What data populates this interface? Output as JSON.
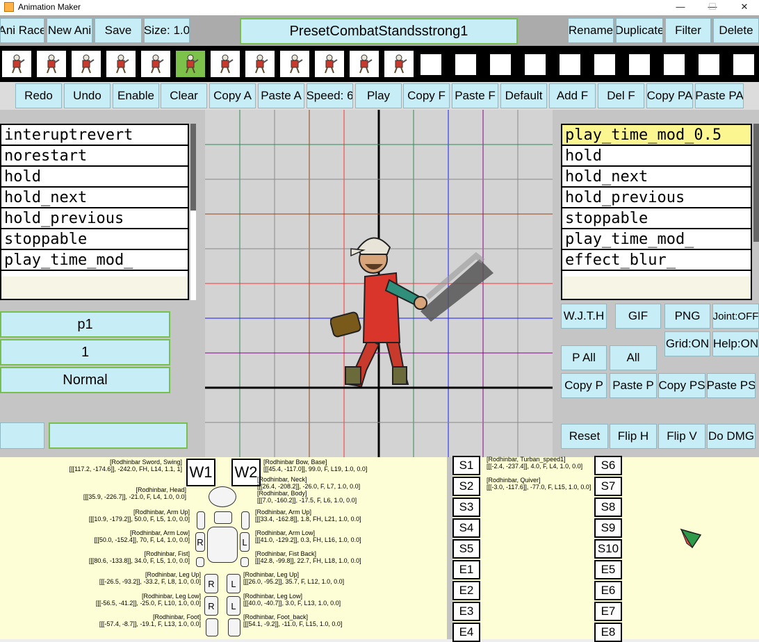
{
  "window": {
    "title": "Animation Maker",
    "minimize": "—",
    "maximize": "☐",
    "close": "✕"
  },
  "top_buttons": {
    "ani_race": "Ani Race",
    "new_ani": "New Ani",
    "save": "Save",
    "size": "Size: 1.0",
    "animation_name": "PresetCombatStandsstrong1",
    "rename": "Rename",
    "duplicate": "Duplicate",
    "filter": "Filter",
    "delete": "Delete"
  },
  "filmstrip": {
    "filled_frames": 12,
    "selected_frame": 6,
    "empty_frames": 10
  },
  "toolbar": [
    "Redo",
    "Undo",
    "Enable",
    "Clear",
    "Copy A",
    "Paste A",
    "Speed: 6",
    "Play",
    "Copy F",
    "Paste F",
    "Default",
    "Add F",
    "Del F",
    "Copy PA",
    "Paste PA"
  ],
  "left_list": [
    "interuptrevert",
    "norestart",
    "hold",
    "hold_next",
    "hold_previous",
    "stoppable",
    "play_time_mod_"
  ],
  "right_list": {
    "items": [
      "play_time_mod_0.5",
      "hold",
      "hold_next",
      "hold_previous",
      "stoppable",
      "play_time_mod_",
      "effect_blur_"
    ],
    "highlighted": "play_time_mod_0.5"
  },
  "left_fields": {
    "p": "p1",
    "value": "1",
    "mode": "Normal"
  },
  "right_buttons": {
    "wjth": "W.J.T.H",
    "gif": "GIF",
    "png": "PNG",
    "joint": "Joint:OFF",
    "grid": "Grid:ON",
    "help": "Help:ON",
    "p_all": "P All",
    "all": "All",
    "copy_p": "Copy P",
    "paste_p": "Paste P",
    "copy_ps": "Copy PS",
    "paste_ps": "Paste PS",
    "reset": "Reset",
    "flip_h": "Flip H",
    "flip_v": "Flip V",
    "do_dmg": "Do DMG"
  },
  "skeleton": {
    "w1": "W1",
    "w2": "W2",
    "r": "R",
    "l": "L",
    "labels_left": [
      {
        "name": "[Rodhinbar Sword, Swing]",
        "value": "[[[117.2, -174.6]], -242.0, FH, L14, 1.1, 1]"
      },
      {
        "name": "[Rodhinbar, Head]",
        "value": "[[[35.9, -226.7]], -21.0, F, L4, 1.0, 0.0]"
      },
      {
        "name": "[Rodhinbar, Arm Up]",
        "value": "[[[10.9, -179.2]], 50.0, F, L5, 1.0, 0.0]"
      },
      {
        "name": "[Rodhinbar, Arm Low]",
        "value": "[[[50.0, -152.4]], 70, F, L4, 1.0, 0.0]"
      },
      {
        "name": "[Rodhinbar, Fist]",
        "value": "[[[80.6, -133.8]], 34.0, F, L5, 1.0, 0.0]"
      },
      {
        "name": "[Rodhinbar, Leg Up]",
        "value": "[[[-26.5, -93.2]], -33.2, F, L8, 1.0, 0.0]"
      },
      {
        "name": "[Rodhinbar, Leg Low]",
        "value": "[[[-56.5, -41.2]], -25.0, F, L10, 1.0, 0.0]"
      },
      {
        "name": "[Rodhinbar, Foot]",
        "value": "[[[-57.4, -8.7]], -19.1, F, L13, 1.0, 0.0]"
      }
    ],
    "labels_right": [
      {
        "name": "[Rodhinbar Bow, Base]",
        "value": "[[[45.4, -117.0]], 99.0, F, L19, 1.0, 0.0]"
      },
      {
        "name": "[Rodhinbar, Neck]",
        "value": "[[[26.4, -208.2]], -26.0, F, L7, 1.0, 0.0]"
      },
      {
        "name": "[Rodhinbar, Body]",
        "value": "[[[7.0, -160.2]], -17.5, F, L6, 1.0, 0.0]"
      },
      {
        "name": "[Rodhinbar, Arm Up]",
        "value": "[[[33.4, -162.8]], 1.8, FH, L21, 1.0, 0.0]"
      },
      {
        "name": "[Rodhinbar, Arm Low]",
        "value": "[[[41.0, -129.2]], 0.3, FH, L16, 1.0, 0.0]"
      },
      {
        "name": "[Rodhinbar, Fist Back]",
        "value": "[[[42.8, -99.8]], 22.7, FH, L18, 1.0, 0.0]"
      },
      {
        "name": "[Rodhinbar, Leg Up]",
        "value": "[[[26.0, -95.2]], 35.7, F, L12, 1.0, 0.0]"
      },
      {
        "name": "[Rodhinbar, Leg Low]",
        "value": "[[[40.0, -40.7]], 3.0, F, L13, 1.0, 0.0]"
      },
      {
        "name": "[Rodhinbar, Foot_back]",
        "value": "[[[54.1, -9.2]], -11.0, F, L15, 1.0, 0.0]"
      }
    ]
  },
  "slots": {
    "left": [
      "S1",
      "S2",
      "S3",
      "S4",
      "S5",
      "E1",
      "E2",
      "E3",
      "E4"
    ],
    "right": [
      "S6",
      "S7",
      "S8",
      "S9",
      "S10",
      "E5",
      "E6",
      "E7",
      "E8"
    ],
    "extra_labels": [
      {
        "name": "[Rodhinbar, Turban_speed1]",
        "value": "[[[-2.4, -237.4]], 4.0, F, L4, 1.0, 0.0]"
      },
      {
        "name": "[Rodhinbar, Quiver]",
        "value": "[[[-3.0, -117.6]], -77.0, F, L15, 1.0, 0.0]"
      }
    ]
  },
  "colors": {
    "button": "#c7eef6",
    "highlight": "#fbf690",
    "panel": "#fefed6",
    "canvas": "#d3d3d3"
  }
}
